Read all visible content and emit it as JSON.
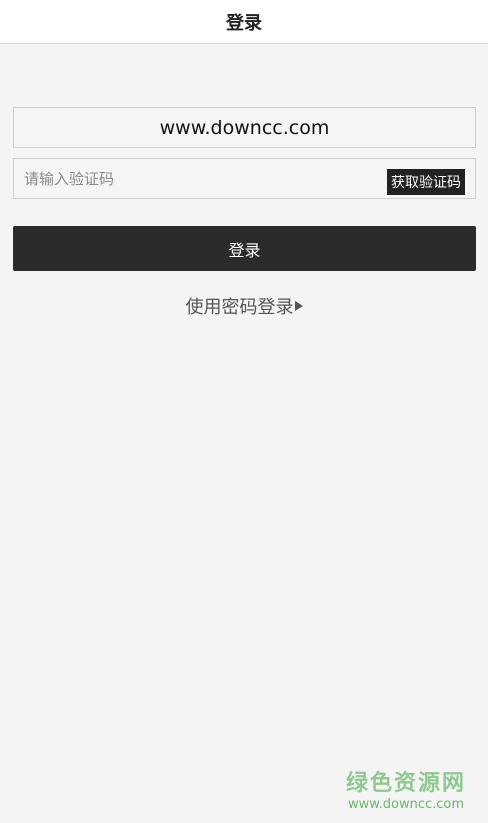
{
  "header": {
    "title": "登录"
  },
  "form": {
    "phone_value": "www.downcc.com",
    "code_placeholder": "请输入验证码",
    "get_code_label": "获取验证码",
    "login_label": "登录",
    "password_login_label": "使用密码登录"
  },
  "watermark": {
    "name": "绿色资源网",
    "url": "www.downcc.com"
  },
  "icons": {
    "password_login_arrow": "play-arrow-icon"
  },
  "colors": {
    "background": "#f4f4f4",
    "button": "#2b2b2b",
    "watermark": "#8fc98f"
  }
}
